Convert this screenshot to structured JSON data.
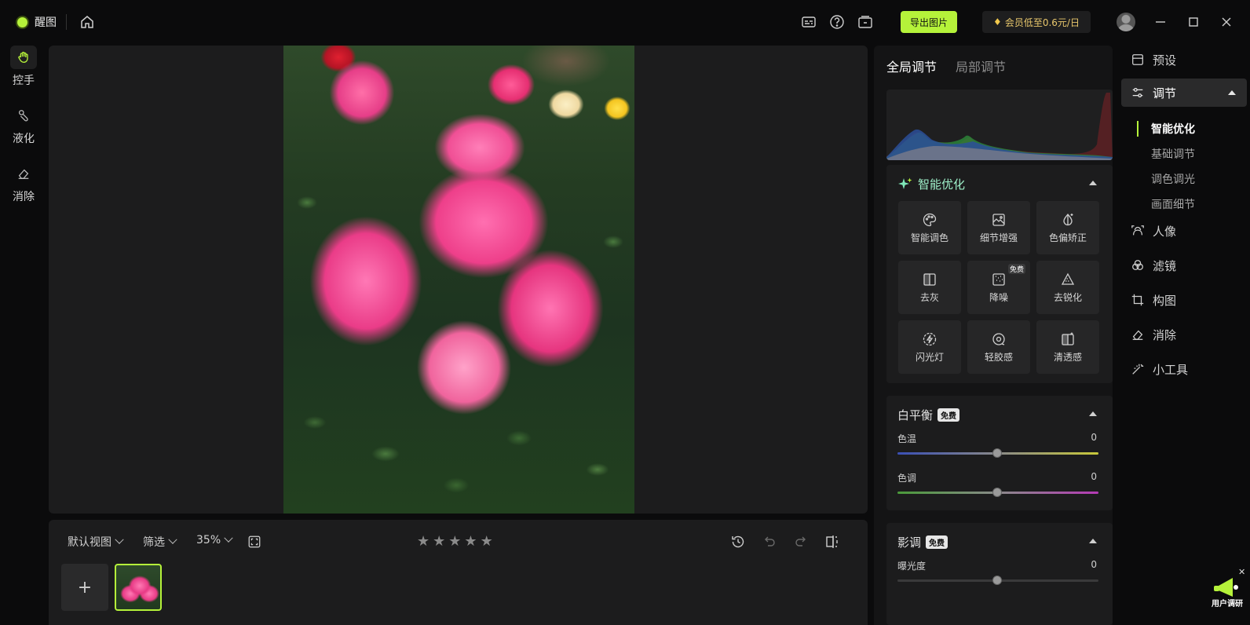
{
  "app": {
    "name": "醒图"
  },
  "header": {
    "export_label": "导出图片",
    "vip_label": "会员低至0.6元/日"
  },
  "left_tools": [
    {
      "label": "控手",
      "icon": "hand-icon",
      "active": true
    },
    {
      "label": "液化",
      "icon": "liquify-icon",
      "active": false
    },
    {
      "label": "消除",
      "icon": "eraser-icon",
      "active": false
    }
  ],
  "bottom_bar": {
    "view_label": "默认视图",
    "filter_label": "筛选",
    "zoom_label": "35%",
    "rating_stars": 5
  },
  "right_panel": {
    "tabs": [
      {
        "label": "全局调节",
        "active": true
      },
      {
        "label": "局部调节",
        "active": false
      }
    ],
    "smart": {
      "title": "智能优化",
      "buttons": [
        {
          "label": "智能调色",
          "icon": "palette-icon"
        },
        {
          "label": "细节增强",
          "icon": "detail-icon"
        },
        {
          "label": "色偏矫正",
          "icon": "color-cast-icon"
        },
        {
          "label": "去灰",
          "icon": "dehaze-icon"
        },
        {
          "label": "降噪",
          "icon": "denoise-icon",
          "badge": "免费"
        },
        {
          "label": "去锐化",
          "icon": "unsharpen-icon"
        },
        {
          "label": "闪光灯",
          "icon": "flash-icon"
        },
        {
          "label": "轻胶感",
          "icon": "film-icon"
        },
        {
          "label": "清透感",
          "icon": "clarity-icon"
        }
      ]
    },
    "white_balance": {
      "title": "白平衡",
      "badge": "免费",
      "sliders": [
        {
          "label": "色温",
          "value": "0"
        },
        {
          "label": "色调",
          "value": "0"
        }
      ]
    },
    "tone": {
      "title": "影调",
      "badge": "免费",
      "sliders": [
        {
          "label": "曝光度",
          "value": "0"
        }
      ]
    }
  },
  "right_nav": {
    "items": [
      {
        "label": "预设",
        "icon": "preset-icon"
      },
      {
        "label": "调节",
        "icon": "sliders-icon",
        "active": true
      },
      {
        "label": "人像",
        "icon": "portrait-icon"
      },
      {
        "label": "滤镜",
        "icon": "filter-icon"
      },
      {
        "label": "构图",
        "icon": "crop-icon"
      },
      {
        "label": "消除",
        "icon": "eraser-icon"
      },
      {
        "label": "小工具",
        "icon": "wand-icon"
      }
    ],
    "sub_items": [
      {
        "label": "智能优化",
        "active": true
      },
      {
        "label": "基础调节"
      },
      {
        "label": "调色调光"
      },
      {
        "label": "画面细节"
      }
    ]
  },
  "survey": {
    "label": "用户调研"
  }
}
